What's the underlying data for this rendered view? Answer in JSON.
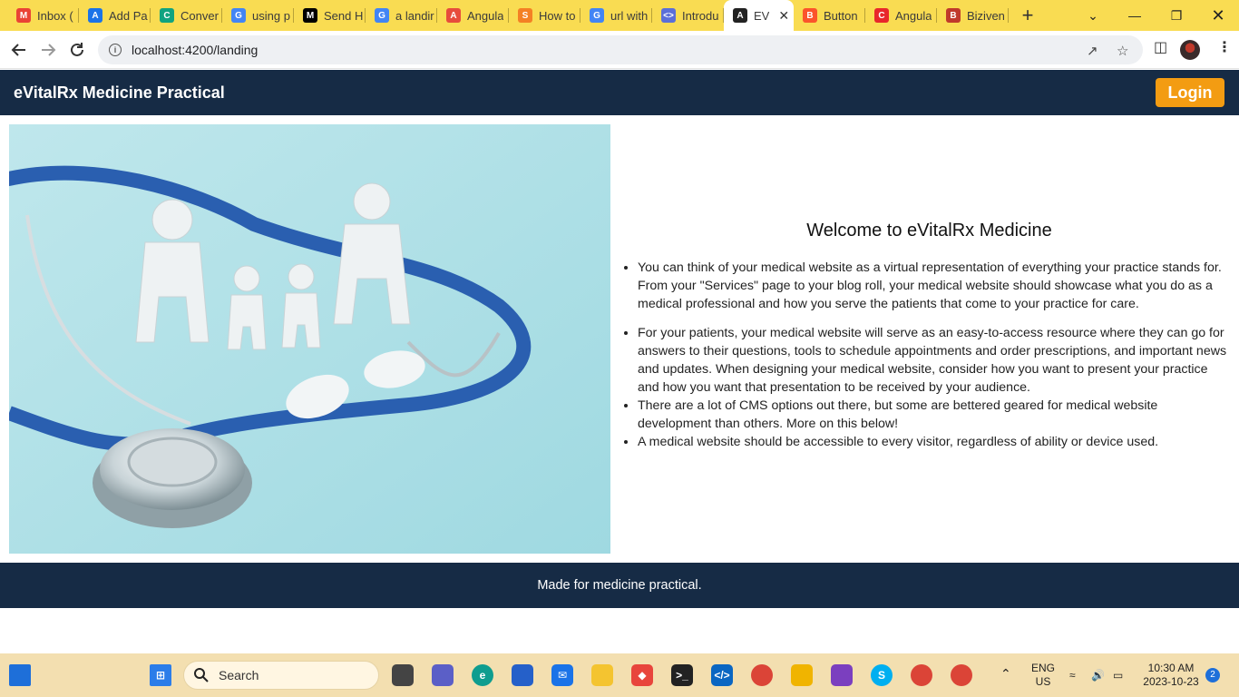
{
  "browser": {
    "tabs": [
      {
        "label": "Inbox (",
        "icon": "gmail-icon",
        "color": "#ea4335",
        "glyph": "M"
      },
      {
        "label": "Add Pa",
        "icon": "account-icon",
        "color": "#1a73e8",
        "glyph": "A"
      },
      {
        "label": "Conver",
        "icon": "chatgpt-icon",
        "color": "#10a37f",
        "glyph": "C"
      },
      {
        "label": "using p",
        "icon": "google-icon",
        "color": "#4285f4",
        "glyph": "G"
      },
      {
        "label": "Send H",
        "icon": "medium-icon",
        "color": "#000000",
        "glyph": "M"
      },
      {
        "label": "a landir",
        "icon": "google-icon",
        "color": "#4285f4",
        "glyph": "G"
      },
      {
        "label": "Angula",
        "icon": "puzzle-icon",
        "color": "#e74c3c",
        "glyph": "A"
      },
      {
        "label": "How to",
        "icon": "stackoverflow-icon",
        "color": "#f48024",
        "glyph": "S"
      },
      {
        "label": "url with",
        "icon": "google-icon",
        "color": "#4285f4",
        "glyph": "G"
      },
      {
        "label": "Introdu",
        "icon": "code-icon",
        "color": "#5b6fd8",
        "glyph": "<>"
      },
      {
        "label": "EV",
        "icon": "angular-icon",
        "color": "#222222",
        "glyph": "A",
        "active": true
      },
      {
        "label": "Button",
        "icon": "brave-icon",
        "color": "#fb542b",
        "glyph": "B"
      },
      {
        "label": "Angula",
        "icon": "coursera-icon",
        "color": "#e8272b",
        "glyph": "C"
      },
      {
        "label": "Biziven",
        "icon": "doc-icon",
        "color": "#c0392b",
        "glyph": "B"
      }
    ],
    "new_tab": "+",
    "url": "localhost:4200/landing"
  },
  "app": {
    "title": "eVitalRx Medicine Practical",
    "login_label": "Login",
    "heading": "Welcome to eVitalRx Medicine",
    "bullets": [
      "You can think of your medical website as a virtual representation of everything your practice stands for. From your \"Services\" page to your blog roll, your medical website should showcase what you do as a medical professional and how you serve the patients that come to your practice for care.",
      "For your patients, your medical website will serve as an easy-to-access resource where they can go for answers to their questions, tools to schedule appointments and order prescriptions, and important news and updates. When designing your medical website, consider how you want to present your practice and how you want that presentation to be received by your audience.",
      "There are a lot of CMS options out there, but some are bettered geared for medical website development than others. More on this below!",
      "A medical website should be accessible to every visitor, regardless of ability or device used."
    ],
    "footer": "Made for medicine practical."
  },
  "taskbar": {
    "search_placeholder": "Search",
    "language": "ENG",
    "region": "US",
    "time": "10:30 AM",
    "date": "2023-10-23",
    "notifications": "2"
  }
}
